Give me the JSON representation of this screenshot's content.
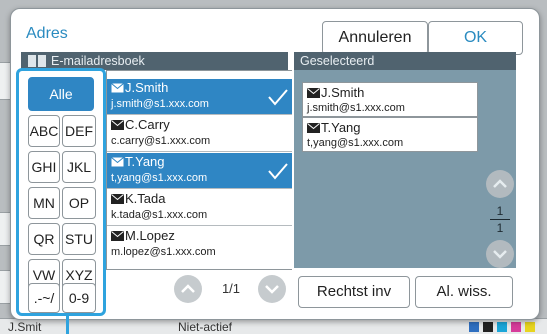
{
  "dialog": {
    "title": "Adres",
    "cancel_label": "Annuleren",
    "ok_label": "OK"
  },
  "left_pane": {
    "header": "E-mailadresboek"
  },
  "right_pane": {
    "header": "Geselecteerd"
  },
  "index_buttons": [
    {
      "label": "Alle",
      "active": true
    },
    {
      "label": "ABC"
    },
    {
      "label": "DEF"
    },
    {
      "label": "GHI"
    },
    {
      "label": "JKL"
    },
    {
      "label": "MN"
    },
    {
      "label": "OP"
    },
    {
      "label": "QR"
    },
    {
      "label": "STU"
    },
    {
      "label": "VW"
    },
    {
      "label": "XYZ"
    },
    {
      "label": ".-~/"
    },
    {
      "label": "0-9"
    }
  ],
  "address_list": [
    {
      "name": "J.Smith",
      "email": "j.smith@s1.xxx.com",
      "selected": true
    },
    {
      "name": "C.Carry",
      "email": "c.carry@s1.xxx.com",
      "selected": false
    },
    {
      "name": "T.Yang",
      "email": "t,yang@s1.xxx.com",
      "selected": true
    },
    {
      "name": "K.Tada",
      "email": "k.tada@s1.xxx.com",
      "selected": false
    },
    {
      "name": "M.Lopez",
      "email": "m.lopez@s1.xxx.com",
      "selected": false
    }
  ],
  "list_pager": {
    "page": "1/1"
  },
  "selected_list": [
    {
      "name": "J.Smith",
      "email": "j.smith@s1.xxx.com"
    },
    {
      "name": "T.Yang",
      "email": "t,yang@s1.xxx.com"
    }
  ],
  "selected_pager": {
    "current": "1",
    "total": "1"
  },
  "actions": {
    "right_inv_label": "Rechtst inv",
    "clear_label": "Al. wiss."
  },
  "background": {
    "user": "J.Smit",
    "status": "Niet-actief",
    "ink_colors": [
      "#2f6fc0",
      "#222222",
      "#1ba6d8",
      "#d63c9a",
      "#e7d41f"
    ]
  },
  "colors": {
    "accent": "#2a8bc0",
    "selection": "#2f86c4",
    "pane_header": "#50636f",
    "selected_pane": "#7d9aa9"
  }
}
